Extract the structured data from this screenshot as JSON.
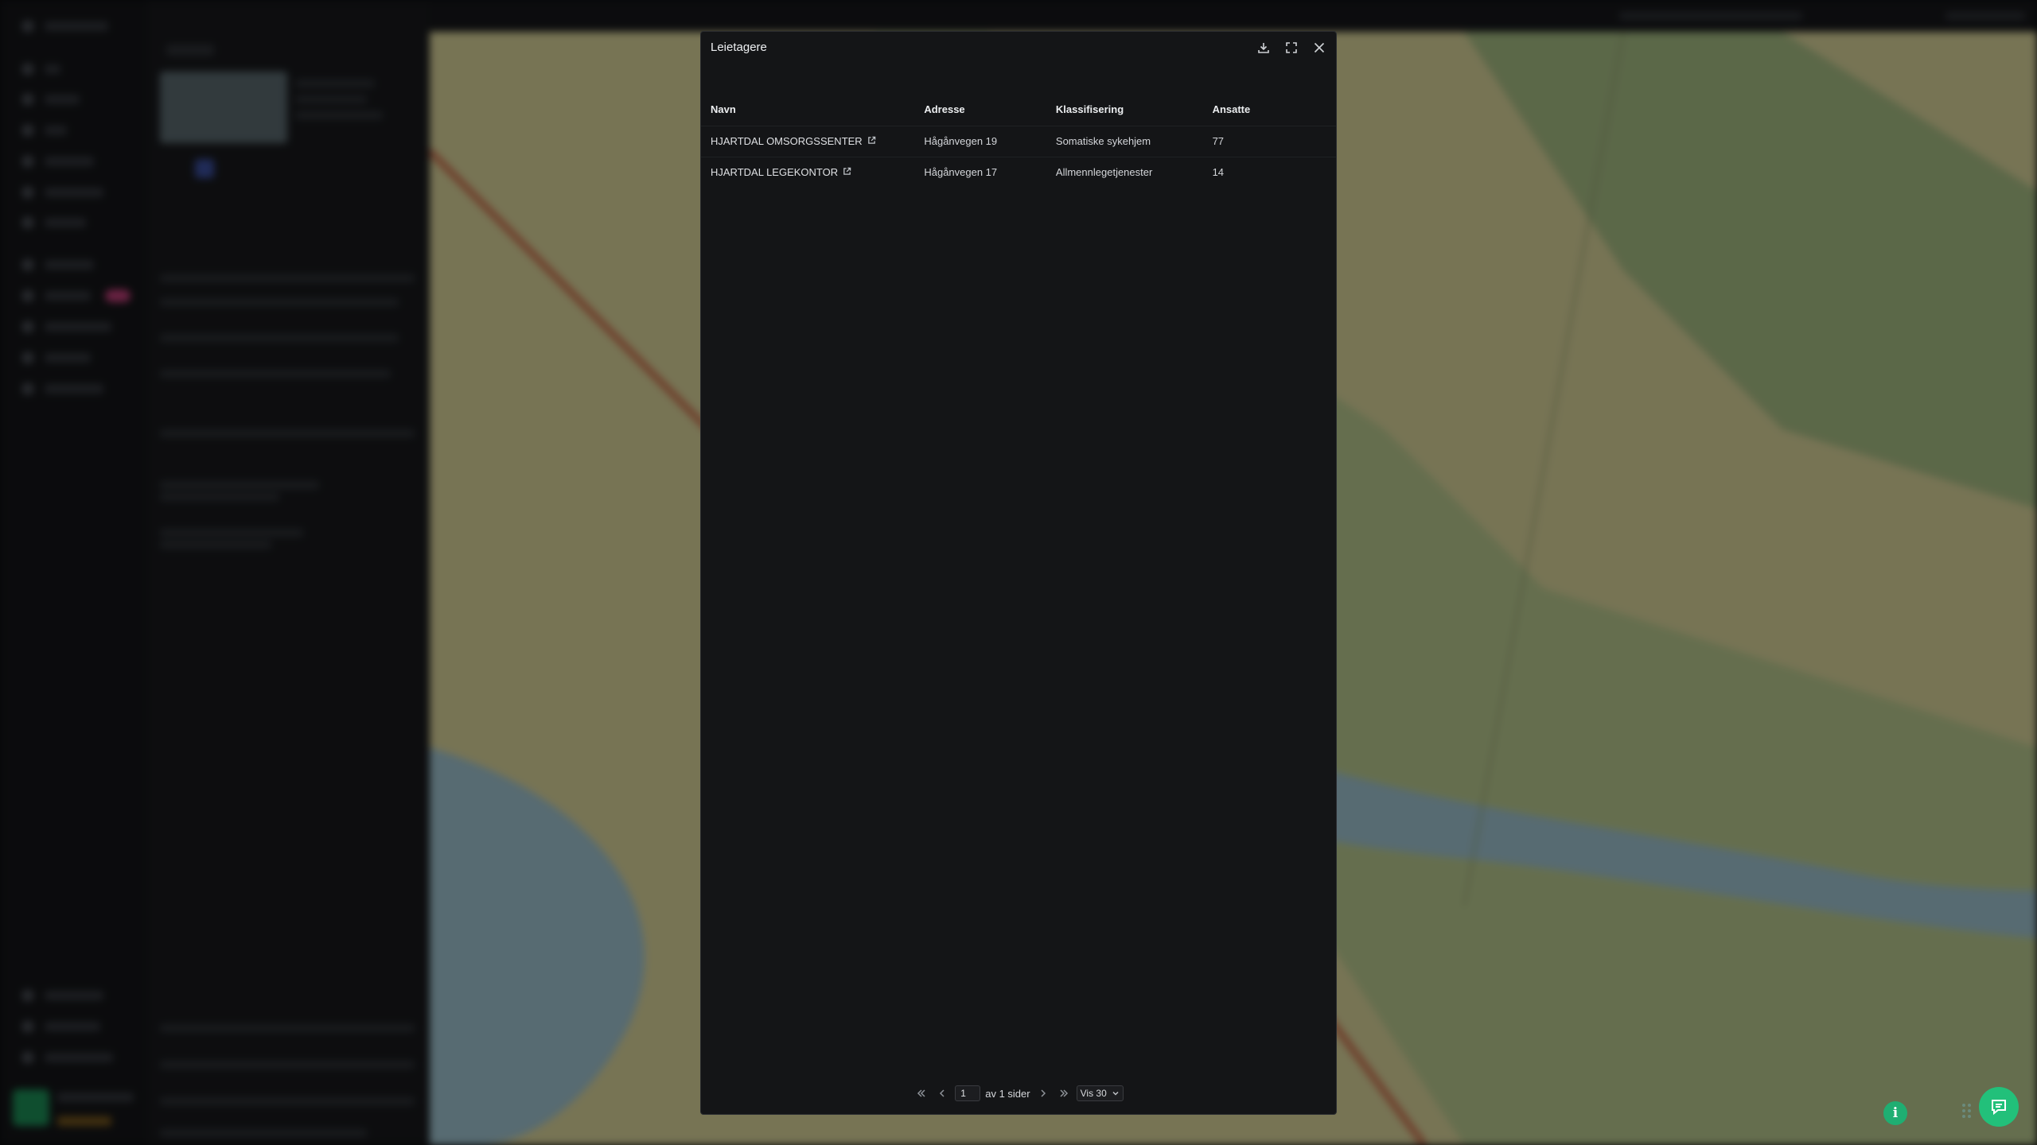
{
  "modal": {
    "title": "Leietagere",
    "download_icon": "download-icon",
    "expand_icon": "expand-icon",
    "close_icon": "close-icon"
  },
  "table": {
    "columns": [
      "Navn",
      "Adresse",
      "Klassifisering",
      "Ansatte"
    ],
    "rows": [
      {
        "navn": "HJARTDAL OMSORGSSENTER",
        "adresse": "Hågånvegen 19",
        "klassifisering": "Somatiske sykehjem",
        "ansatte": "77"
      },
      {
        "navn": "HJARTDAL LEGEKONTOR",
        "adresse": "Hågånvegen 17",
        "klassifisering": "Allmennlegetjenester",
        "ansatte": "14"
      }
    ]
  },
  "pagination": {
    "current_page": "1",
    "of_pages_label": "av 1 sider",
    "per_page_label": "Vis 30"
  },
  "colors": {
    "accent_green": "#22c07a",
    "modal_bg": "#141517",
    "map_land": "#d9d39a",
    "map_water": "#9fc3cf"
  },
  "floating": {
    "info_label": "i",
    "chat_icon": "chat-icon",
    "info_icon": "info-icon"
  }
}
